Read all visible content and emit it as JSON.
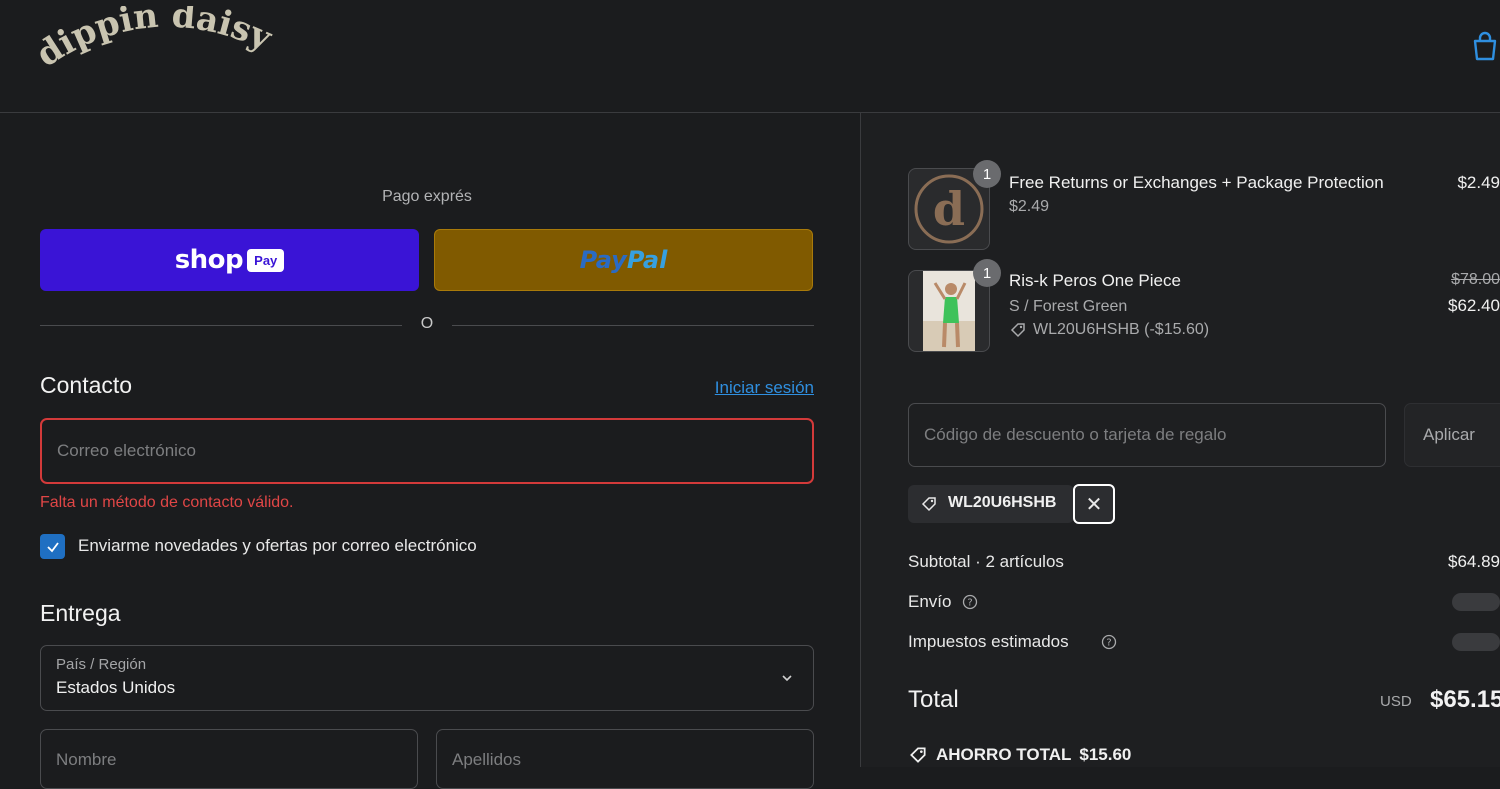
{
  "header": {
    "logo_text": "dippin daisys",
    "cart_icon": "shopping-bag-icon"
  },
  "express": {
    "label": "Pago exprés",
    "shop_pay": {
      "word": "shop",
      "badge": "Pay",
      "color": "#3a14d6"
    },
    "paypal": {
      "part1": "Pay",
      "part2": "Pal",
      "color": "#805a00"
    },
    "or_text": "O"
  },
  "contact": {
    "title": "Contacto",
    "login_link": "Iniciar sesión",
    "email_placeholder": "Correo electrónico",
    "error": "Falta un método de contacto válido.",
    "newsletter_label": "Enviarme novedades y ofertas por correo electrónico",
    "newsletter_checked": true
  },
  "delivery": {
    "title": "Entrega",
    "country_label": "País / Región",
    "country_value": "Estados Unidos",
    "first_name_placeholder": "Nombre",
    "last_name_placeholder": "Apellidos"
  },
  "summary": {
    "items": [
      {
        "qty": "1",
        "title": "Free Returns or Exchanges + Package Protection",
        "sub": "$2.49",
        "price": "$2.49",
        "thumb": "d-logo"
      },
      {
        "qty": "1",
        "title": "Ris-k Peros One Piece",
        "variant": "S / Forest Green",
        "discount": "WL20U6HSHB (-$15.60)",
        "original_price": "$78.00",
        "price": "$62.40",
        "thumb": "swimsuit-photo"
      }
    ],
    "discount_placeholder": "Código de descuento o tarjeta de regalo",
    "apply_label": "Aplicar",
    "applied_code": "WL20U6HSHB",
    "subtotal_label": "Subtotal · 2 artículos",
    "subtotal_value": "$64.89",
    "shipping_label": "Envío",
    "taxes_label": "Impuestos estimados",
    "total_label": "Total",
    "total_currency": "USD",
    "total_value": "$65.15",
    "savings_label": "AHORRO TOTAL",
    "savings_value": "$15.60"
  }
}
